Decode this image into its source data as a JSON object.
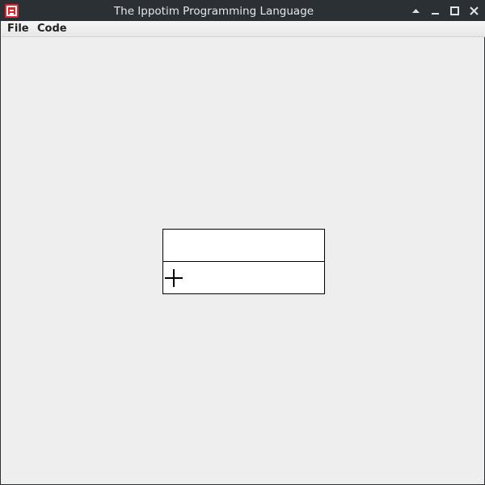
{
  "window": {
    "title": "The Ippotim Programming Language",
    "app_icon": "ippotim-app-icon",
    "controls": [
      "shade-icon",
      "minimize-icon",
      "maximize-icon",
      "close-icon"
    ]
  },
  "menubar": {
    "items": [
      {
        "label": "File"
      },
      {
        "label": "Code"
      }
    ]
  },
  "editor": {
    "rows": [
      {
        "content": ""
      },
      {
        "content": "",
        "icon": "plus-icon"
      }
    ]
  },
  "colors": {
    "titlebar": "#2b3035",
    "workspace": "#eeeeee",
    "app_icon": "#e0262a",
    "cell_border": "#000000",
    "cell_background": "#ffffff"
  }
}
